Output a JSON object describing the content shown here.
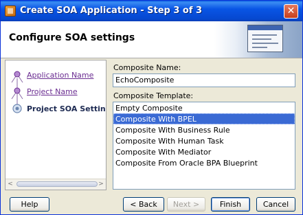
{
  "window": {
    "title": "Create SOA Application - Step 3 of 3",
    "close_glyph": "✕"
  },
  "header": {
    "title": "Configure SOA settings"
  },
  "steps": [
    {
      "label": "Application Name",
      "state": "done"
    },
    {
      "label": "Project Name",
      "state": "done"
    },
    {
      "label": "Project SOA Settings",
      "state": "current"
    }
  ],
  "form": {
    "composite_name_label": "Composite Name:",
    "composite_name_value": "EchoComposite",
    "composite_template_label": "Composite Template:",
    "templates": [
      "Empty Composite",
      "Composite With BPEL",
      "Composite With Business Rule",
      "Composite With Human Task",
      "Composite With Mediator",
      "Composite From Oracle BPA Blueprint"
    ],
    "selected_template": "Composite With BPEL"
  },
  "buttons": {
    "help": "Help",
    "back": "< Back",
    "next": "Next >",
    "finish": "Finish",
    "cancel": "Cancel"
  },
  "scrollbar": {
    "left_arrow": "<",
    "right_arrow": ">"
  },
  "colors": {
    "titlebar": "#0955e5",
    "selection": "#3a6ad4",
    "link": "#6a2c91"
  }
}
